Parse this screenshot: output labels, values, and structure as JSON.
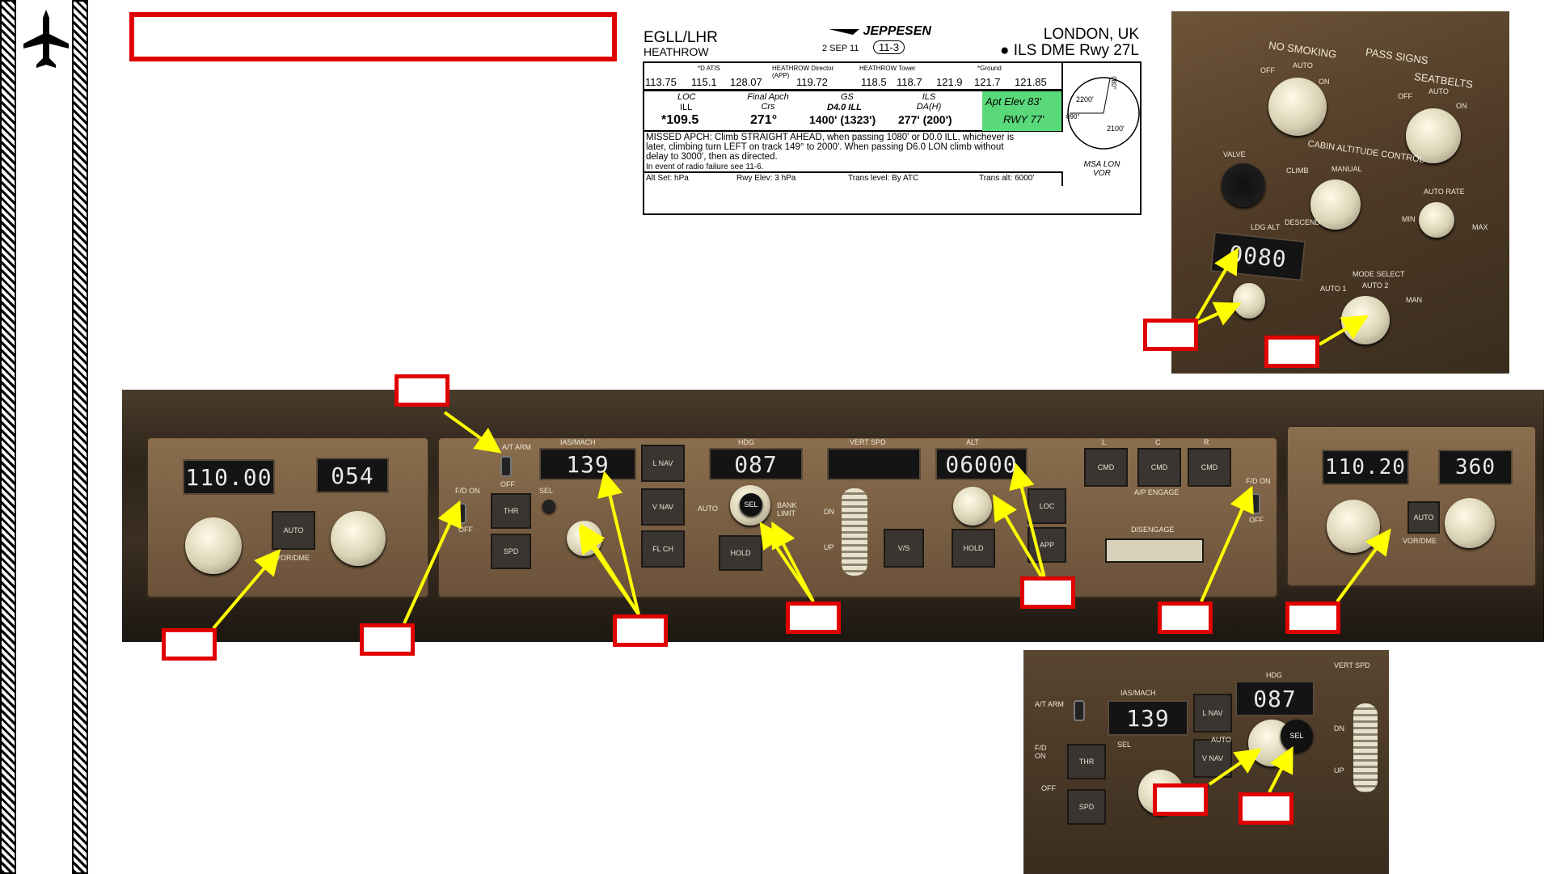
{
  "title_box": "",
  "chart": {
    "airport_id": "EGLL/LHR",
    "airport_name": "HEATHROW",
    "brand": "JEPPESEN",
    "date": "2 SEP 11",
    "page": "11-3",
    "city": "LONDON, UK",
    "procedure": "ILS DME Rwy 27L",
    "freq_headers": [
      "*D ATIS",
      "HEATHROW Director (APP)",
      "HEATHROW Tower",
      "*Ground"
    ],
    "freqs": [
      "113.75",
      "115.1",
      "128.07",
      "119.72",
      "118.5",
      "118.7",
      "121.9",
      "121.7",
      "121.85"
    ],
    "loc_label": "LOC",
    "loc_ident": "ILL",
    "loc_freq": "*109.5",
    "final_label": "Final Apch Crs",
    "final_crs": "271°",
    "gs_label": "GS",
    "gs_fix": "D4.0 ILL",
    "gs_alt": "1400' (1323')",
    "ils_label": "ILS DA(H)",
    "ils_da": "277' (200')",
    "apt_elev": "Apt Elev 83'",
    "rwy_elev": "RWY 77'",
    "msa_alt1": "2200'",
    "msa_alt2": "2100'",
    "msa_brg1": "080°",
    "msa_brg2": "090°",
    "msa_label": "MSA LON VOR",
    "missed_apch": "MISSED APCH: Climb STRAIGHT AHEAD, when passing 1080' or D0.0 ILL, whichever is later, climbing turn LEFT on track 149° to 2000'. When passing D6.0 LON climb without delay to 3000', then as directed.",
    "radio_fail": "In event of radio failure see 11-6.",
    "alt_set": "Alt Set: hPa",
    "rwy_elev_set": "Rwy Elev: 3 hPa",
    "trans_level": "Trans level: By ATC",
    "trans_alt": "Trans alt: 6000'"
  },
  "cabin_panel": {
    "no_smoking": "NO SMOKING",
    "pass_signs": "PASS SIGNS",
    "seatbelts": "SEATBELTS",
    "off": "OFF",
    "auto": "AUTO",
    "on": "ON",
    "cabin_alt_control": "CABIN ALTITUDE CONTROL",
    "valve": "VALVE",
    "climb": "CLIMB",
    "manual": "MANUAL",
    "descend": "DESCEND",
    "auto_rate": "AUTO RATE",
    "min": "MIN",
    "max": "MAX",
    "ldg_alt_label": "LDG ALT",
    "ldg_alt_value": "0080",
    "mode_select": "MODE SELECT",
    "auto1": "AUTO 1",
    "auto2": "AUTO 2",
    "man": "MAN"
  },
  "mcp": {
    "left_course_freq": "110.00",
    "left_course": "054",
    "auto_label": "AUTO",
    "vor_dme": "VOR/DME",
    "at_arm": "A/T ARM",
    "fd_on": "F/D ON",
    "off": "OFF",
    "ias_mach_label": "IAS/MACH",
    "ias_value": "139",
    "sel": "SEL",
    "thr": "THR",
    "spd": "SPD",
    "lnav": "L NAV",
    "vnav": "V NAV",
    "flch": "FL CH",
    "hdg_label": "HDG",
    "hdg_value": "087",
    "hdg_auto": "AUTO",
    "bank_limit": "BANK LIMIT",
    "hdg_hold": "HOLD",
    "vert_spd_label": "VERT SPD",
    "vert_spd_value": "",
    "dn": "DN",
    "up": "UP",
    "vs": "V/S",
    "alt_label": "ALT",
    "alt_value": "06000",
    "alt_hold": "HOLD",
    "loc": "LOC",
    "app": "APP",
    "cmd_l": "L",
    "cmd_c": "C",
    "cmd_r": "R",
    "cmd": "CMD",
    "ap_engage": "A/P ENGAGE",
    "disengage": "DISENGAGE",
    "right_course_freq": "110.20",
    "right_course": "360"
  },
  "zoom": {
    "at_arm": "A/T ARM",
    "ias_mach_label": "IAS/MACH",
    "ias_value": "139",
    "lnav": "L NAV",
    "hdg_label": "HDG",
    "hdg_value": "087",
    "vert_spd_label": "VERT SPD",
    "fd_on": "F/D ON",
    "off": "OFF",
    "sel": "SEL",
    "thr": "THR",
    "vnav": "V NAV",
    "hdg_auto": "AUTO",
    "spd": "SPD",
    "dn": "DN",
    "up": "UP"
  },
  "callouts": [
    "",
    "",
    "",
    "",
    "",
    "",
    "",
    "",
    "",
    "",
    "",
    ""
  ]
}
